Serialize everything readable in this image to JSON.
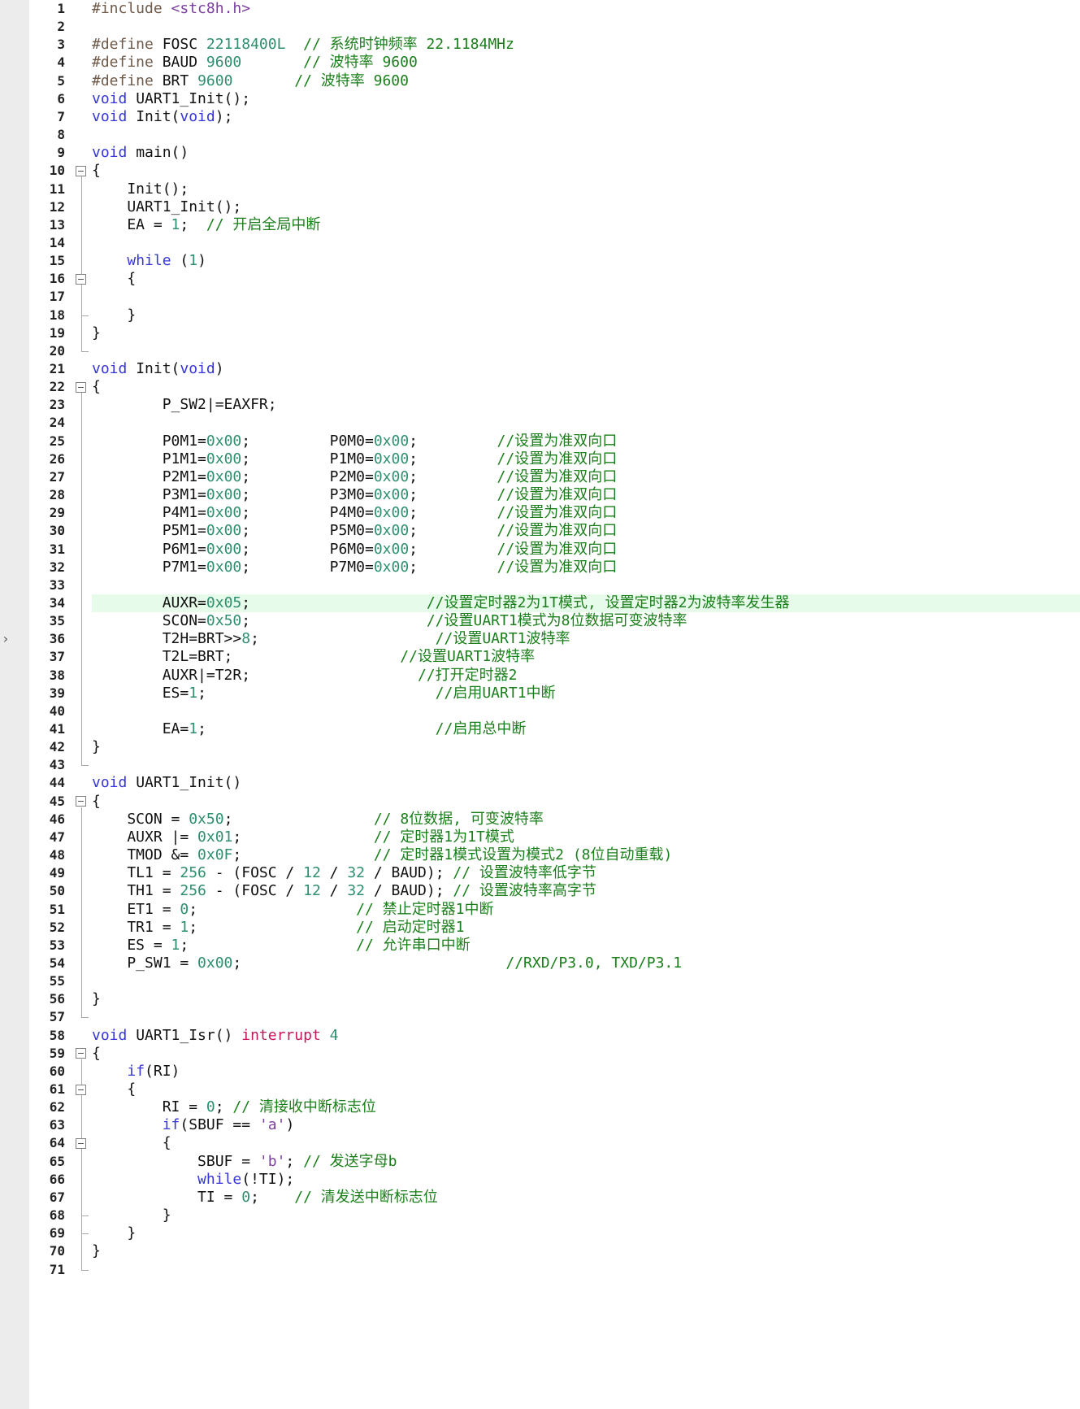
{
  "editor": {
    "current_line": 34,
    "lines": [
      {
        "n": "1",
        "fold": "",
        "tokens": [
          [
            "pp",
            "#include "
          ],
          [
            "str",
            "<stc8h.h>"
          ]
        ]
      },
      {
        "n": "2",
        "fold": "",
        "tokens": []
      },
      {
        "n": "3",
        "fold": "",
        "tokens": [
          [
            "pp",
            "#define "
          ],
          [
            "tx",
            "FOSC "
          ],
          [
            "num",
            "22118400L"
          ],
          [
            "tx",
            "  "
          ],
          [
            "cm",
            "// 系统时钟频率 22.1184MHz"
          ]
        ]
      },
      {
        "n": "4",
        "fold": "",
        "tokens": [
          [
            "pp",
            "#define "
          ],
          [
            "tx",
            "BAUD "
          ],
          [
            "num",
            "9600"
          ],
          [
            "tx",
            "       "
          ],
          [
            "cm",
            "// 波特率 9600"
          ]
        ]
      },
      {
        "n": "5",
        "fold": "",
        "tokens": [
          [
            "pp",
            "#define "
          ],
          [
            "tx",
            "BRT "
          ],
          [
            "num",
            "9600"
          ],
          [
            "tx",
            "       "
          ],
          [
            "cm",
            "// 波特率 9600"
          ]
        ]
      },
      {
        "n": "6",
        "fold": "",
        "tokens": [
          [
            "k",
            "void "
          ],
          [
            "tx",
            "UART1_Init();"
          ]
        ]
      },
      {
        "n": "7",
        "fold": "",
        "tokens": [
          [
            "k",
            "void "
          ],
          [
            "tx",
            "Init("
          ],
          [
            "k",
            "void"
          ],
          [
            "tx",
            ");"
          ]
        ]
      },
      {
        "n": "8",
        "fold": "",
        "tokens": []
      },
      {
        "n": "9",
        "fold": "",
        "tokens": [
          [
            "k",
            "void "
          ],
          [
            "tx",
            "main()"
          ]
        ]
      },
      {
        "n": "10",
        "fold": "box",
        "tokens": [
          [
            "tx",
            "{"
          ]
        ]
      },
      {
        "n": "11",
        "fold": "",
        "tokens": [
          [
            "tx",
            "    Init();"
          ]
        ]
      },
      {
        "n": "12",
        "fold": "",
        "tokens": [
          [
            "tx",
            "    UART1_Init();"
          ]
        ]
      },
      {
        "n": "13",
        "fold": "",
        "tokens": [
          [
            "tx",
            "    EA = "
          ],
          [
            "num",
            "1"
          ],
          [
            "tx",
            ";  "
          ],
          [
            "cm",
            "// 开启全局中断"
          ]
        ]
      },
      {
        "n": "14",
        "fold": "",
        "tokens": []
      },
      {
        "n": "15",
        "fold": "",
        "tokens": [
          [
            "tx",
            "    "
          ],
          [
            "k",
            "while "
          ],
          [
            "tx",
            "("
          ],
          [
            "num",
            "1"
          ],
          [
            "tx",
            ")"
          ]
        ]
      },
      {
        "n": "16",
        "fold": "box",
        "tokens": [
          [
            "tx",
            "    {"
          ]
        ]
      },
      {
        "n": "17",
        "fold": "",
        "tokens": []
      },
      {
        "n": "18",
        "fold": "end",
        "tokens": [
          [
            "tx",
            "    }"
          ]
        ]
      },
      {
        "n": "19",
        "fold": "",
        "tokens": [
          [
            "tx",
            "}"
          ]
        ]
      },
      {
        "n": "20",
        "fold": "end",
        "tokens": []
      },
      {
        "n": "21",
        "fold": "",
        "tokens": [
          [
            "k",
            "void "
          ],
          [
            "tx",
            "Init("
          ],
          [
            "k",
            "void"
          ],
          [
            "tx",
            ")"
          ]
        ]
      },
      {
        "n": "22",
        "fold": "box",
        "tokens": [
          [
            "tx",
            "{"
          ]
        ]
      },
      {
        "n": "23",
        "fold": "",
        "tokens": [
          [
            "tx",
            "        P_SW2|=EAXFR;"
          ]
        ]
      },
      {
        "n": "24",
        "fold": "",
        "tokens": []
      },
      {
        "n": "25",
        "fold": "",
        "tokens": [
          [
            "tx",
            "        P0M1="
          ],
          [
            "num",
            "0x00"
          ],
          [
            "tx",
            ";         P0M0="
          ],
          [
            "num",
            "0x00"
          ],
          [
            "tx",
            ";         "
          ],
          [
            "cm",
            "//设置为准双向口"
          ]
        ]
      },
      {
        "n": "26",
        "fold": "",
        "tokens": [
          [
            "tx",
            "        P1M1="
          ],
          [
            "num",
            "0x00"
          ],
          [
            "tx",
            ";         P1M0="
          ],
          [
            "num",
            "0x00"
          ],
          [
            "tx",
            ";         "
          ],
          [
            "cm",
            "//设置为准双向口"
          ]
        ]
      },
      {
        "n": "27",
        "fold": "",
        "tokens": [
          [
            "tx",
            "        P2M1="
          ],
          [
            "num",
            "0x00"
          ],
          [
            "tx",
            ";         P2M0="
          ],
          [
            "num",
            "0x00"
          ],
          [
            "tx",
            ";         "
          ],
          [
            "cm",
            "//设置为准双向口"
          ]
        ]
      },
      {
        "n": "28",
        "fold": "",
        "tokens": [
          [
            "tx",
            "        P3M1="
          ],
          [
            "num",
            "0x00"
          ],
          [
            "tx",
            ";         P3M0="
          ],
          [
            "num",
            "0x00"
          ],
          [
            "tx",
            ";         "
          ],
          [
            "cm",
            "//设置为准双向口"
          ]
        ]
      },
      {
        "n": "29",
        "fold": "",
        "tokens": [
          [
            "tx",
            "        P4M1="
          ],
          [
            "num",
            "0x00"
          ],
          [
            "tx",
            ";         P4M0="
          ],
          [
            "num",
            "0x00"
          ],
          [
            "tx",
            ";         "
          ],
          [
            "cm",
            "//设置为准双向口"
          ]
        ]
      },
      {
        "n": "30",
        "fold": "",
        "tokens": [
          [
            "tx",
            "        P5M1="
          ],
          [
            "num",
            "0x00"
          ],
          [
            "tx",
            ";         P5M0="
          ],
          [
            "num",
            "0x00"
          ],
          [
            "tx",
            ";         "
          ],
          [
            "cm",
            "//设置为准双向口"
          ]
        ]
      },
      {
        "n": "31",
        "fold": "",
        "tokens": [
          [
            "tx",
            "        P6M1="
          ],
          [
            "num",
            "0x00"
          ],
          [
            "tx",
            ";         P6M0="
          ],
          [
            "num",
            "0x00"
          ],
          [
            "tx",
            ";         "
          ],
          [
            "cm",
            "//设置为准双向口"
          ]
        ]
      },
      {
        "n": "32",
        "fold": "",
        "tokens": [
          [
            "tx",
            "        P7M1="
          ],
          [
            "num",
            "0x00"
          ],
          [
            "tx",
            ";         P7M0="
          ],
          [
            "num",
            "0x00"
          ],
          [
            "tx",
            ";         "
          ],
          [
            "cm",
            "//设置为准双向口"
          ]
        ]
      },
      {
        "n": "33",
        "fold": "",
        "tokens": []
      },
      {
        "n": "34",
        "fold": "",
        "tokens": [
          [
            "tx",
            "        AUXR="
          ],
          [
            "num",
            "0x05"
          ],
          [
            "tx",
            ";                    "
          ],
          [
            "cm",
            "//设置定时器2为1T模式, 设置定时器2为波特率发生器"
          ]
        ]
      },
      {
        "n": "35",
        "fold": "",
        "tokens": [
          [
            "tx",
            "        SCON="
          ],
          [
            "num",
            "0x50"
          ],
          [
            "tx",
            ";                    "
          ],
          [
            "cm",
            "//设置UART1模式为8位数据可变波特率"
          ]
        ]
      },
      {
        "n": "36",
        "fold": "",
        "tokens": [
          [
            "tx",
            "        T2H=BRT>>"
          ],
          [
            "num",
            "8"
          ],
          [
            "tx",
            ";                    "
          ],
          [
            "cm",
            "//设置UART1波特率"
          ]
        ]
      },
      {
        "n": "37",
        "fold": "",
        "tokens": [
          [
            "tx",
            "        T2L=BRT;                   "
          ],
          [
            "cm",
            "//设置UART1波特率"
          ]
        ]
      },
      {
        "n": "38",
        "fold": "",
        "tokens": [
          [
            "tx",
            "        AUXR|=T2R;                   "
          ],
          [
            "cm",
            "//打开定时器2"
          ]
        ]
      },
      {
        "n": "39",
        "fold": "",
        "tokens": [
          [
            "tx",
            "        ES="
          ],
          [
            "num",
            "1"
          ],
          [
            "tx",
            ";                          "
          ],
          [
            "cm",
            "//启用UART1中断"
          ]
        ]
      },
      {
        "n": "40",
        "fold": "",
        "tokens": []
      },
      {
        "n": "41",
        "fold": "",
        "tokens": [
          [
            "tx",
            "        EA="
          ],
          [
            "num",
            "1"
          ],
          [
            "tx",
            ";                          "
          ],
          [
            "cm",
            "//启用总中断"
          ]
        ]
      },
      {
        "n": "42",
        "fold": "",
        "tokens": [
          [
            "tx",
            "}"
          ]
        ]
      },
      {
        "n": "43",
        "fold": "end",
        "tokens": []
      },
      {
        "n": "44",
        "fold": "",
        "tokens": [
          [
            "k",
            "void "
          ],
          [
            "tx",
            "UART1_Init()"
          ]
        ]
      },
      {
        "n": "45",
        "fold": "box",
        "tokens": [
          [
            "tx",
            "{"
          ]
        ]
      },
      {
        "n": "46",
        "fold": "",
        "tokens": [
          [
            "tx",
            "    SCON = "
          ],
          [
            "num",
            "0x50"
          ],
          [
            "tx",
            ";                "
          ],
          [
            "cm",
            "// 8位数据, 可变波特率"
          ]
        ]
      },
      {
        "n": "47",
        "fold": "",
        "tokens": [
          [
            "tx",
            "    AUXR |= "
          ],
          [
            "num",
            "0x01"
          ],
          [
            "tx",
            ";               "
          ],
          [
            "cm",
            "// 定时器1为1T模式"
          ]
        ]
      },
      {
        "n": "48",
        "fold": "",
        "tokens": [
          [
            "tx",
            "    TMOD &= "
          ],
          [
            "num",
            "0x0F"
          ],
          [
            "tx",
            ";               "
          ],
          [
            "cm",
            "// 定时器1模式设置为模式2 (8位自动重载)"
          ]
        ]
      },
      {
        "n": "49",
        "fold": "",
        "tokens": [
          [
            "tx",
            "    TL1 = "
          ],
          [
            "num",
            "256"
          ],
          [
            "tx",
            " - (FOSC / "
          ],
          [
            "num",
            "12"
          ],
          [
            "tx",
            " / "
          ],
          [
            "num",
            "32"
          ],
          [
            "tx",
            " / BAUD); "
          ],
          [
            "cm",
            "// 设置波特率低字节"
          ]
        ]
      },
      {
        "n": "50",
        "fold": "",
        "tokens": [
          [
            "tx",
            "    TH1 = "
          ],
          [
            "num",
            "256"
          ],
          [
            "tx",
            " - (FOSC / "
          ],
          [
            "num",
            "12"
          ],
          [
            "tx",
            " / "
          ],
          [
            "num",
            "32"
          ],
          [
            "tx",
            " / BAUD); "
          ],
          [
            "cm",
            "// 设置波特率高字节"
          ]
        ]
      },
      {
        "n": "51",
        "fold": "",
        "tokens": [
          [
            "tx",
            "    ET1 = "
          ],
          [
            "num",
            "0"
          ],
          [
            "tx",
            ";                  "
          ],
          [
            "cm",
            "// 禁止定时器1中断"
          ]
        ]
      },
      {
        "n": "52",
        "fold": "",
        "tokens": [
          [
            "tx",
            "    TR1 = "
          ],
          [
            "num",
            "1"
          ],
          [
            "tx",
            ";                  "
          ],
          [
            "cm",
            "// 启动定时器1"
          ]
        ]
      },
      {
        "n": "53",
        "fold": "",
        "tokens": [
          [
            "tx",
            "    ES = "
          ],
          [
            "num",
            "1"
          ],
          [
            "tx",
            ";                   "
          ],
          [
            "cm",
            "// 允许串口中断"
          ]
        ]
      },
      {
        "n": "54",
        "fold": "",
        "tokens": [
          [
            "tx",
            "    P_SW1 = "
          ],
          [
            "num",
            "0x00"
          ],
          [
            "tx",
            ";                              "
          ],
          [
            "cm",
            "//RXD/P3.0, TXD/P3.1"
          ]
        ]
      },
      {
        "n": "55",
        "fold": "",
        "tokens": []
      },
      {
        "n": "56",
        "fold": "",
        "tokens": [
          [
            "tx",
            "}"
          ]
        ]
      },
      {
        "n": "57",
        "fold": "end",
        "tokens": []
      },
      {
        "n": "58",
        "fold": "",
        "tokens": [
          [
            "k",
            "void "
          ],
          [
            "tx",
            "UART1_Isr() "
          ],
          [
            "kr",
            "interrupt "
          ],
          [
            "num",
            "4"
          ]
        ]
      },
      {
        "n": "59",
        "fold": "box",
        "tokens": [
          [
            "tx",
            "{"
          ]
        ]
      },
      {
        "n": "60",
        "fold": "",
        "tokens": [
          [
            "tx",
            "    "
          ],
          [
            "k",
            "if"
          ],
          [
            "tx",
            "(RI)"
          ]
        ]
      },
      {
        "n": "61",
        "fold": "box",
        "tokens": [
          [
            "tx",
            "    {"
          ]
        ]
      },
      {
        "n": "62",
        "fold": "",
        "tokens": [
          [
            "tx",
            "        RI = "
          ],
          [
            "num",
            "0"
          ],
          [
            "tx",
            "; "
          ],
          [
            "cm",
            "// 清接收中断标志位"
          ]
        ]
      },
      {
        "n": "63",
        "fold": "",
        "tokens": [
          [
            "tx",
            "        "
          ],
          [
            "k",
            "if"
          ],
          [
            "tx",
            "(SBUF == "
          ],
          [
            "str",
            "'a'"
          ],
          [
            "tx",
            ")"
          ]
        ]
      },
      {
        "n": "64",
        "fold": "box",
        "tokens": [
          [
            "tx",
            "        {"
          ]
        ]
      },
      {
        "n": "65",
        "fold": "",
        "tokens": [
          [
            "tx",
            "            SBUF = "
          ],
          [
            "str",
            "'b'"
          ],
          [
            "tx",
            "; "
          ],
          [
            "cm",
            "// 发送字母b"
          ]
        ]
      },
      {
        "n": "66",
        "fold": "",
        "tokens": [
          [
            "tx",
            "            "
          ],
          [
            "k",
            "while"
          ],
          [
            "tx",
            "(!TI);"
          ]
        ]
      },
      {
        "n": "67",
        "fold": "",
        "tokens": [
          [
            "tx",
            "            TI = "
          ],
          [
            "num",
            "0"
          ],
          [
            "tx",
            ";    "
          ],
          [
            "cm",
            "// 清发送中断标志位"
          ]
        ]
      },
      {
        "n": "68",
        "fold": "end",
        "tokens": [
          [
            "tx",
            "        }"
          ]
        ]
      },
      {
        "n": "69",
        "fold": "end",
        "tokens": [
          [
            "tx",
            "    }"
          ]
        ]
      },
      {
        "n": "70",
        "fold": "",
        "tokens": [
          [
            "tx",
            "}"
          ]
        ]
      },
      {
        "n": "71",
        "fold": "end",
        "tokens": []
      }
    ]
  }
}
